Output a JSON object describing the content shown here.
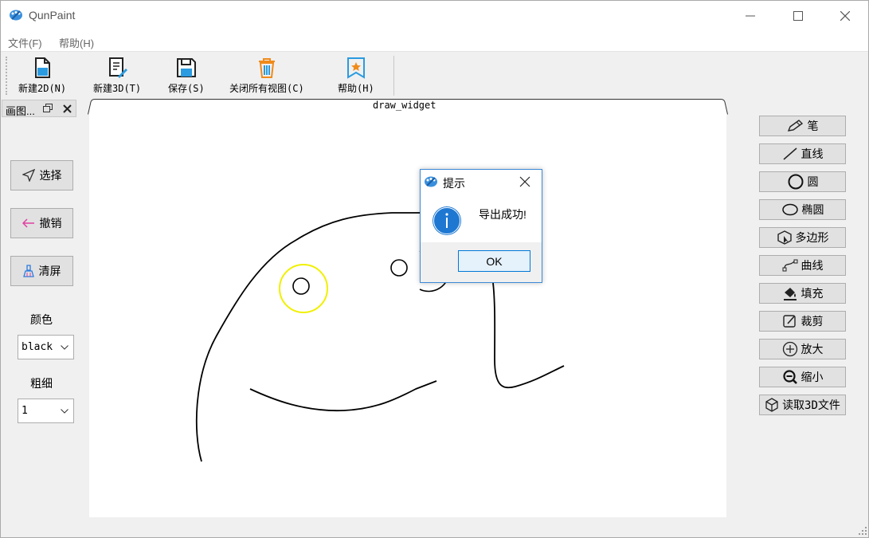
{
  "window": {
    "title": "QunPaint"
  },
  "menu": {
    "file": "文件(F)",
    "help": "帮助(H)"
  },
  "toolbar": {
    "items": [
      {
        "label": "新建2D(N)",
        "icon": "new-file-icon"
      },
      {
        "label": "新建3D(T)",
        "icon": "document-edit-icon"
      },
      {
        "label": "保存(S)",
        "icon": "save-icon"
      },
      {
        "label": "关闭所有视图(C)",
        "icon": "trash-icon"
      },
      {
        "label": "帮助(H)",
        "icon": "help-star-icon"
      }
    ]
  },
  "dock": {
    "title": "画图..."
  },
  "left_panel": {
    "select": "选择",
    "undo": "撤销",
    "clear": "清屏",
    "color_label": "颜色",
    "color_value": "black",
    "width_label": "粗细",
    "width_value": "1"
  },
  "canvas": {
    "title": "draw_widget"
  },
  "right_panel": {
    "tools": [
      {
        "label": "笔",
        "icon": "pencil-icon"
      },
      {
        "label": "直线",
        "icon": "line-icon"
      },
      {
        "label": "圆",
        "icon": "circle-icon"
      },
      {
        "label": "椭圆",
        "icon": "ellipse-icon"
      },
      {
        "label": "多边形",
        "icon": "polygon-icon"
      },
      {
        "label": "曲线",
        "icon": "curve-icon"
      },
      {
        "label": "填充",
        "icon": "fill-bucket-icon"
      },
      {
        "label": "裁剪",
        "icon": "crop-icon"
      },
      {
        "label": "放大",
        "icon": "zoom-in-icon"
      },
      {
        "label": "缩小",
        "icon": "zoom-out-icon"
      },
      {
        "label": "读取3D文件",
        "icon": "cube-icon"
      }
    ]
  },
  "dialog": {
    "title": "提示",
    "message": "导出成功!",
    "ok": "OK"
  },
  "colors": {
    "accent": "#0078d7",
    "highlight_circle": "#f0f000",
    "info_blue": "#1e78d2"
  }
}
